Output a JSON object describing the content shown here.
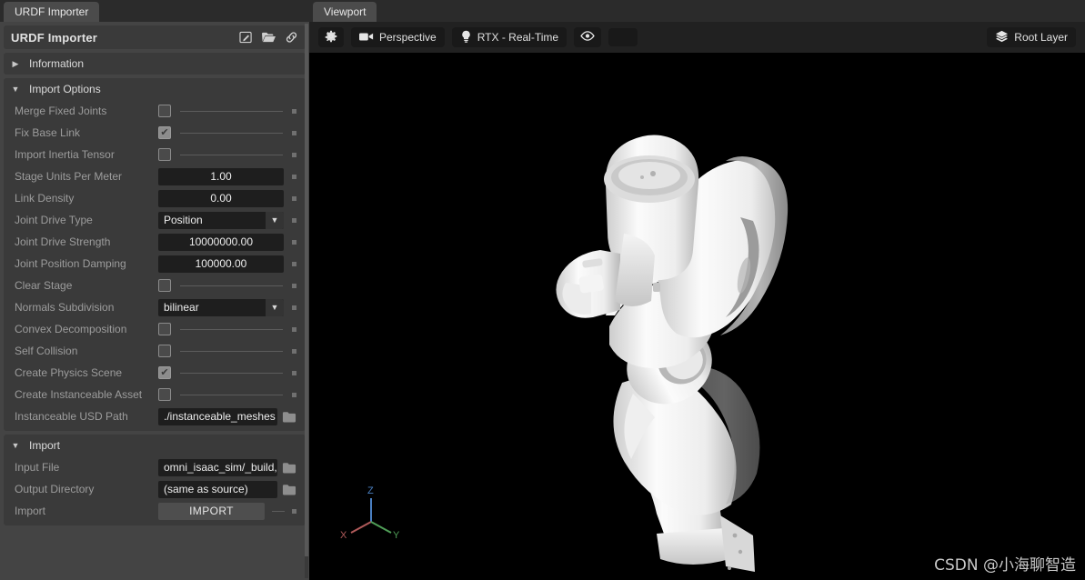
{
  "left_panel": {
    "tab": {
      "label": "URDF Importer"
    },
    "title": {
      "label": "URDF Importer"
    },
    "title_icons": [
      {
        "name": "edit-icon",
        "glyph": "edit"
      },
      {
        "name": "open-folder-icon",
        "glyph": "folder-open"
      },
      {
        "name": "link-icon",
        "glyph": "link"
      }
    ],
    "sections": [
      {
        "key": "information",
        "label": "Information",
        "expanded": false,
        "caret": "▶"
      },
      {
        "key": "import_options",
        "label": "Import Options",
        "expanded": true,
        "caret": "▼"
      }
    ],
    "import_options": [
      {
        "label": "Merge Fixed Joints",
        "type": "checkbox",
        "checked": false
      },
      {
        "label": "Fix Base Link",
        "type": "checkbox",
        "checked": true
      },
      {
        "label": "Import Inertia Tensor",
        "type": "checkbox",
        "checked": false
      },
      {
        "label": "Stage Units Per Meter",
        "type": "number",
        "value": "1.00"
      },
      {
        "label": "Link Density",
        "type": "number",
        "value": "0.00"
      },
      {
        "label": "Joint Drive Type",
        "type": "combo",
        "value": "Position"
      },
      {
        "label": "Joint Drive Strength",
        "type": "number",
        "value": "10000000.00"
      },
      {
        "label": "Joint Position Damping",
        "type": "number",
        "value": "100000.00"
      },
      {
        "label": "Clear Stage",
        "type": "checkbox",
        "checked": false
      },
      {
        "label": "Normals Subdivision",
        "type": "combo",
        "value": "bilinear"
      },
      {
        "label": "Convex Decomposition",
        "type": "checkbox",
        "checked": false
      },
      {
        "label": "Self Collision",
        "type": "checkbox",
        "checked": false
      },
      {
        "label": "Create Physics Scene",
        "type": "checkbox",
        "checked": true
      },
      {
        "label": "Create Instanceable Asset",
        "type": "checkbox",
        "checked": false
      },
      {
        "label": "Instanceable USD Path",
        "type": "path",
        "value": "./instanceable_meshes"
      }
    ],
    "import_section": {
      "header": {
        "label": "Import",
        "caret": "▼"
      },
      "rows": [
        {
          "label": "Input File",
          "type": "path",
          "value": "omni_isaac_sim/_build,"
        },
        {
          "label": "Output Directory",
          "type": "path",
          "value": "(same as source)"
        },
        {
          "label": "Import",
          "type": "button",
          "value": "IMPORT"
        }
      ]
    }
  },
  "viewport": {
    "tab": {
      "label": "Viewport"
    },
    "toolbar": {
      "settings_icon": "gear-icon",
      "camera": {
        "label": "Perspective",
        "icon": "camera-icon"
      },
      "renderer": {
        "label": "RTX - Real-Time",
        "icon": "lightbulb-icon"
      },
      "visibility_icon": "eye-icon",
      "blank_button": "",
      "layer": {
        "label": "Root Layer",
        "icon": "layers-icon"
      }
    },
    "axis_gizmo": {
      "x": {
        "label": "X",
        "color": "#b05a5a"
      },
      "y": {
        "label": "Y",
        "color": "#4f9e57"
      },
      "z": {
        "label": "Z",
        "color": "#4a7fc1"
      }
    },
    "watermark": "CSDN @小海聊智造"
  }
}
